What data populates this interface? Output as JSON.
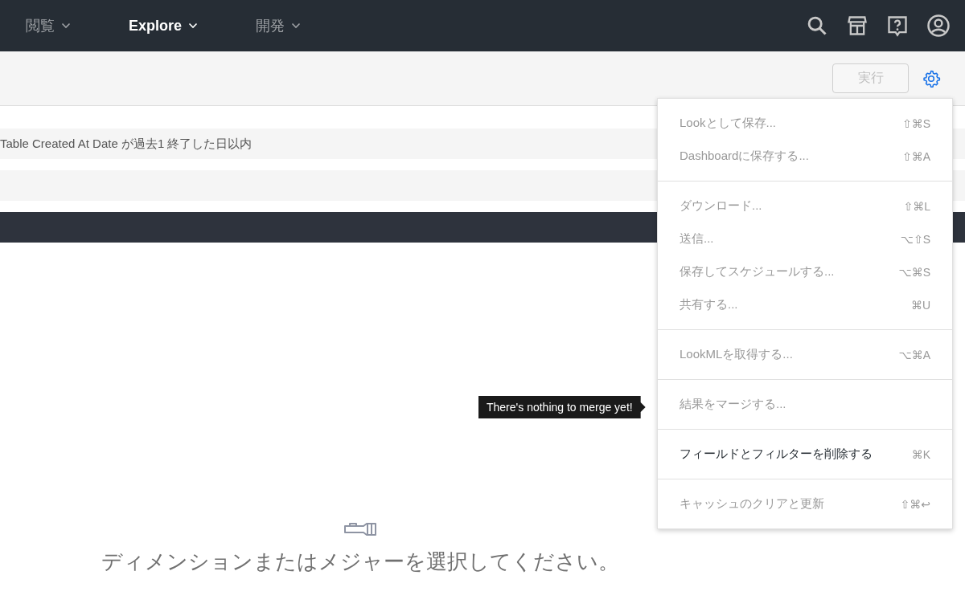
{
  "nav": {
    "items": [
      {
        "label": "閲覧",
        "selected": false
      },
      {
        "label": "Explore",
        "selected": true
      },
      {
        "label": "開発",
        "selected": false
      }
    ]
  },
  "toolbar": {
    "run_button": {
      "label": "実行",
      "disabled": true
    }
  },
  "filters": [
    {
      "text": "Table Created At Date が過去1 終了した日以内"
    }
  ],
  "menu": {
    "groups": [
      {
        "items": [
          {
            "label": "Lookとして保存...",
            "shortcut": "⇧⌘S",
            "disabled": true
          },
          {
            "label": "Dashboardに保存する...",
            "shortcut": "⇧⌘A",
            "disabled": true
          }
        ]
      },
      {
        "items": [
          {
            "label": "ダウンロード...",
            "shortcut": "⇧⌘L",
            "disabled": true
          },
          {
            "label": "送信...",
            "shortcut": "⌥⇧S",
            "disabled": true
          },
          {
            "label": "保存してスケジュールする...",
            "shortcut": "⌥⌘S",
            "disabled": true
          },
          {
            "label": "共有する...",
            "shortcut": "⌘U",
            "disabled": true
          }
        ]
      },
      {
        "items": [
          {
            "label": "LookMLを取得する...",
            "shortcut": "⌥⌘A",
            "disabled": true
          }
        ]
      },
      {
        "items": [
          {
            "label": "結果をマージする...",
            "disabled": true
          }
        ]
      },
      {
        "items": [
          {
            "label": "フィールドとフィルターを削除する",
            "shortcut": "⌘K",
            "disabled": false
          }
        ]
      },
      {
        "items": [
          {
            "label": "キャッシュのクリアと更新",
            "shortcut": "⇧⌘↩",
            "disabled": true
          }
        ]
      }
    ]
  },
  "tooltip": {
    "text": "There's nothing to merge yet!"
  },
  "empty_state": {
    "message": "ディメンションまたはメジャーを選択してください。"
  }
}
